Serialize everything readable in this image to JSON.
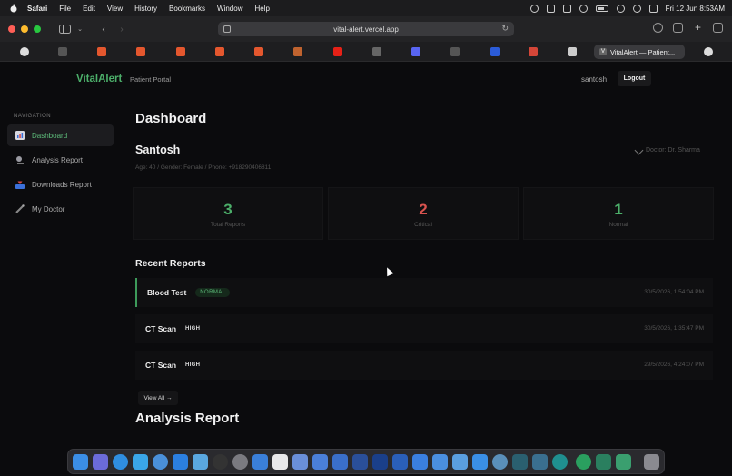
{
  "menubar": {
    "app": "Safari",
    "menus": [
      "File",
      "Edit",
      "View",
      "History",
      "Bookmarks",
      "Window",
      "Help"
    ],
    "clock": "Fri 12 Jun  8:53AM"
  },
  "browser": {
    "url": "vital-alert.vercel.app",
    "active_tab": "VitalAlert — Patient...",
    "active_tab_letter": "V"
  },
  "header": {
    "brand": "VitalAlert",
    "subtitle": "Patient Portal",
    "user": "santosh",
    "logout": "Logout"
  },
  "sidebar": {
    "heading": "NAVIGATION",
    "items": [
      {
        "label": "Dashboard",
        "icon": "bar-chart-icon",
        "color": "#5dbb7a"
      },
      {
        "label": "Analysis Report",
        "icon": "microscope-icon",
        "color": "#aaaaaa"
      },
      {
        "label": "Downloads Report",
        "icon": "inbox-tray-icon",
        "color": "#aaaaaa"
      },
      {
        "label": "My Doctor",
        "icon": "stethoscope-icon",
        "color": "#aaaaaa"
      }
    ]
  },
  "main": {
    "title": "Dashboard",
    "patient": {
      "name": "Santosh",
      "meta": "Age: 40 / Gender: Female / Phone: +918290406811",
      "doctor": "Doctor: Dr. Sharma"
    },
    "stats": [
      {
        "value": "3",
        "label": "Total Reports",
        "color": "#4caf6a"
      },
      {
        "value": "2",
        "label": "Critical",
        "color": "#d9534f"
      },
      {
        "value": "1",
        "label": "Normal",
        "color": "#4caf6a"
      }
    ],
    "recent_title": "Recent Reports",
    "reports": [
      {
        "name": "Blood Test",
        "status": "NORMAL",
        "time": "30/5/2026, 1:54:04 PM"
      },
      {
        "name": "CT Scan",
        "status": "HIGH",
        "time": "30/5/2026, 1:35:47 PM"
      },
      {
        "name": "CT Scan",
        "status": "HIGH",
        "time": "29/5/2026, 4:24:07 PM"
      }
    ],
    "view_all": "View All →",
    "next_section": "Analysis Report"
  },
  "colors": {
    "accent": "#4caf6a",
    "critical": "#d9534f",
    "background": "#0b0b0d"
  }
}
